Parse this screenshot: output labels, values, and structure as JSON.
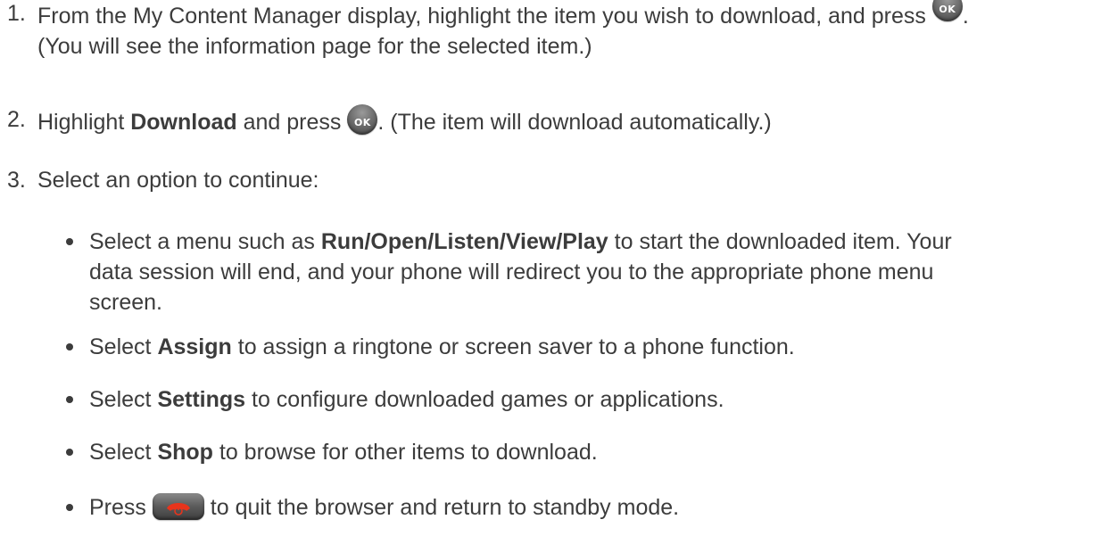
{
  "steps": [
    {
      "number": "1.",
      "line1": "From the My Content Manager display, highlight the item you wish to download, and press",
      "after_key": ".",
      "line2": "(You will see the information page for the selected item.)"
    },
    {
      "number": "2.",
      "pre": "Highlight ",
      "bold": "Download",
      "mid": " and press",
      "after_key": ". (The item will download automatically.)"
    },
    {
      "number": "3.",
      "text": "Select an option to continue:"
    }
  ],
  "bullets": [
    {
      "pre": "Select a menu such as ",
      "bold": "Run/Open/Listen/View/Play",
      "post": " to start the downloaded item. Your data session will end, and your phone will redirect you to the appropriate phone menu screen."
    },
    {
      "pre": "Select ",
      "bold": "Assign",
      "post": " to assign a ringtone or screen saver to a phone function."
    },
    {
      "pre": "Select ",
      "bold": "Settings",
      "post": " to configure downloaded games or applications."
    },
    {
      "pre": "Select ",
      "bold": "Shop",
      "post": " to browse for other items to download."
    },
    {
      "pre": "Press",
      "post": " to quit the browser and return to standby mode."
    }
  ],
  "keys": {
    "ok_label": "OK",
    "ok_icon": "ok-key-icon",
    "end_icon": "end-call-key-icon",
    "end_color": "#e8341c"
  }
}
